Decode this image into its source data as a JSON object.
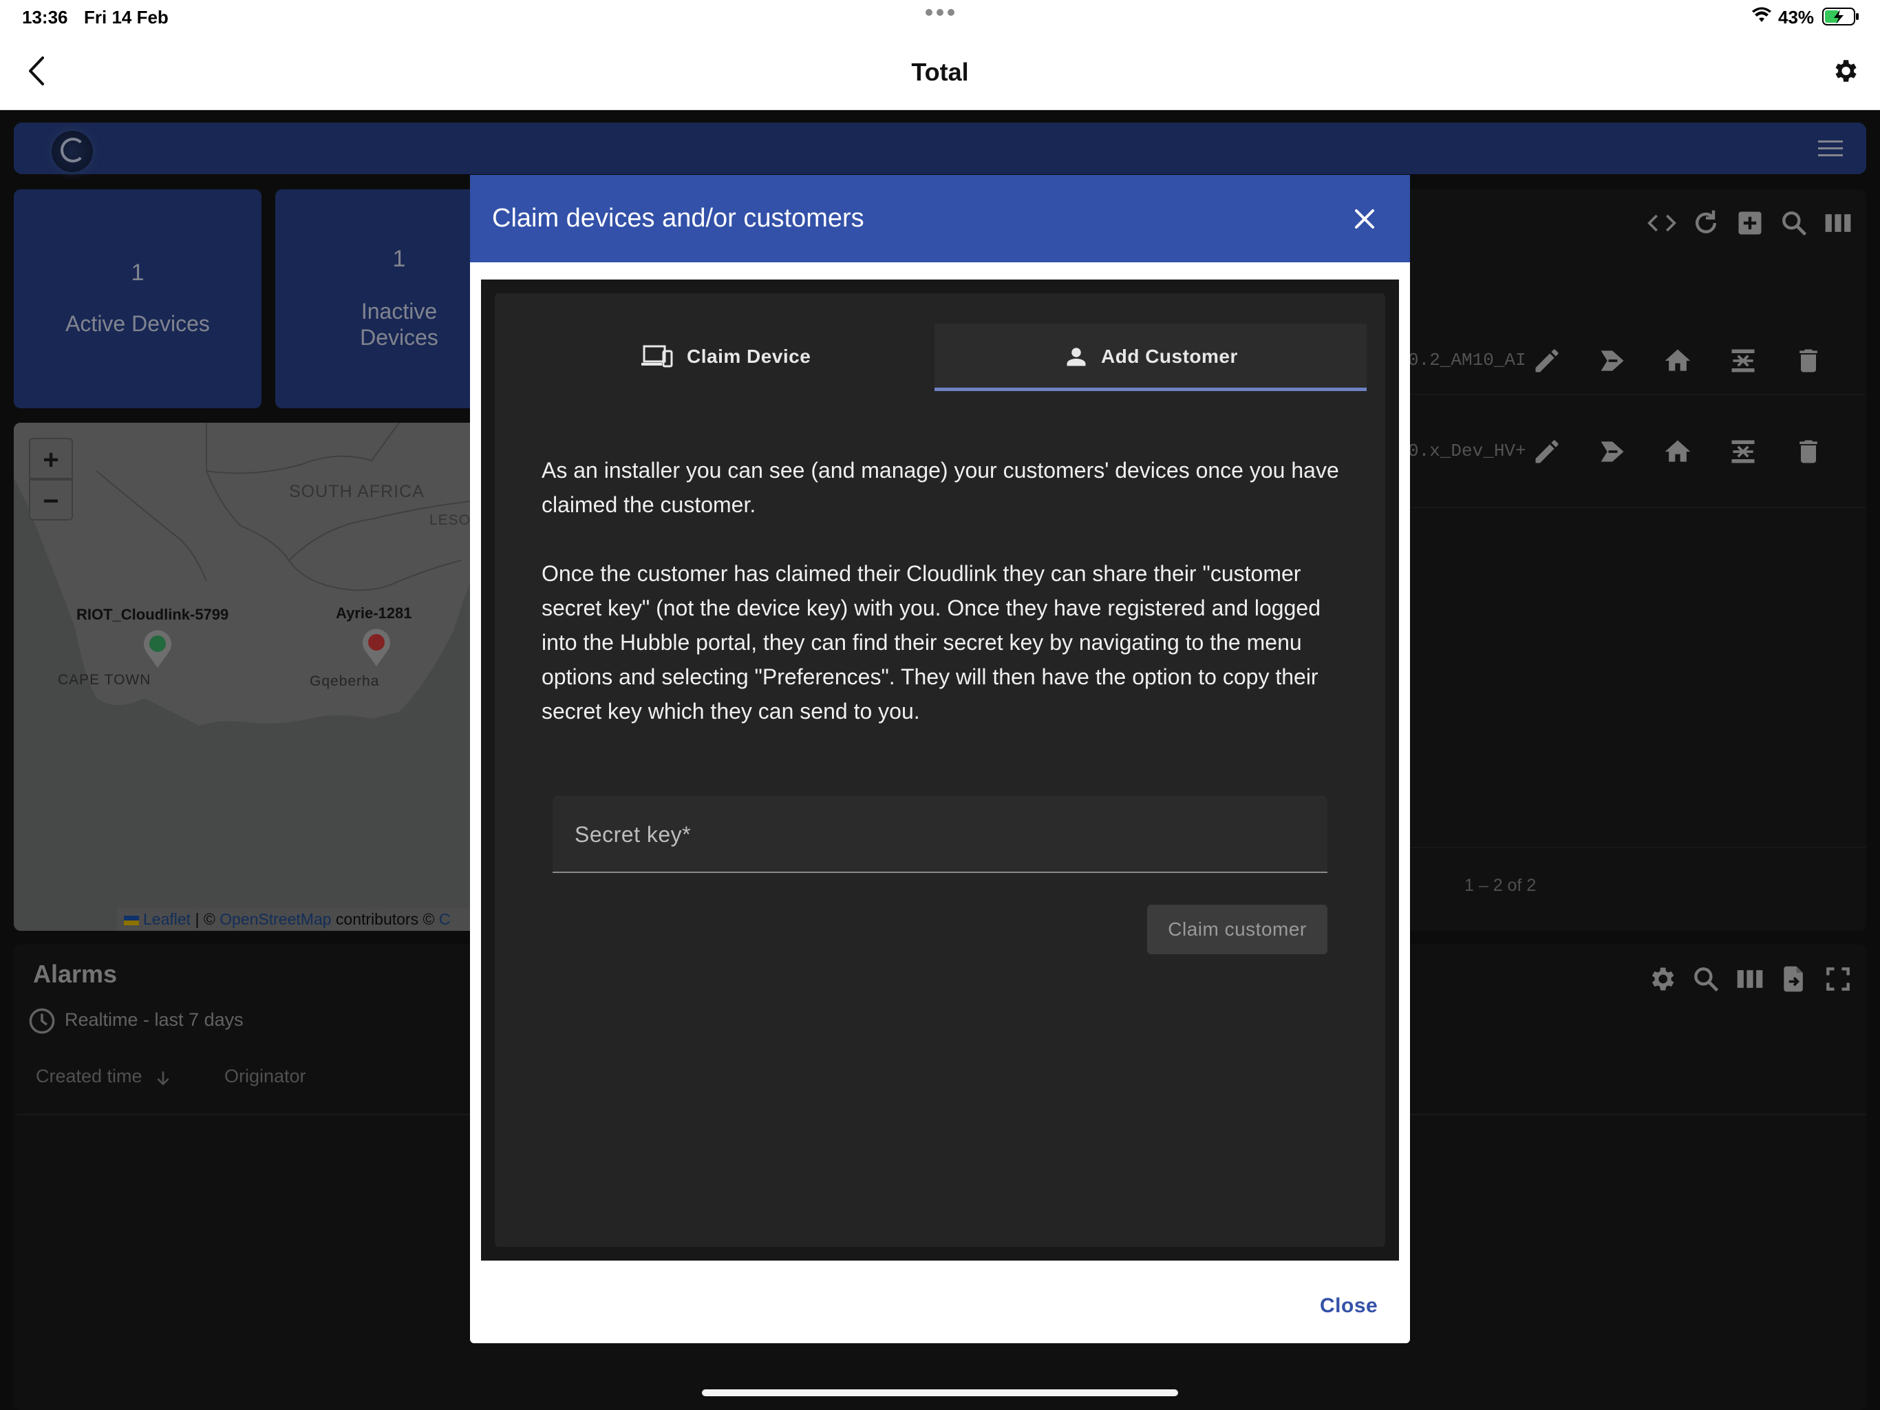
{
  "status_bar": {
    "time": "13:36",
    "date": "Fri 14 Feb",
    "battery": "43%"
  },
  "nav": {
    "title": "Total"
  },
  "cards": [
    {
      "count": "1",
      "label": "Active Devices"
    },
    {
      "count": "1",
      "label_line1": "Inactive",
      "label_line2": "Devices"
    }
  ],
  "map": {
    "region_label": "SOUTH AFRICA",
    "region_label_partial": "LESO",
    "markers": [
      {
        "name": "RIOT_Cloudlink-5799",
        "status": "active",
        "color": "#3cb56b"
      },
      {
        "name": "Ayrie-1281",
        "status": "inactive",
        "color": "#e23b3b"
      }
    ],
    "cities": [
      "CAPE TOWN",
      "Gqeberha"
    ],
    "zoom_in": "+",
    "zoom_out": "−",
    "attribution": {
      "leaflet": "Leaflet",
      "sep": " | © ",
      "osm": "OpenStreetMap",
      "contrib": " contributors © ",
      "tail": "C"
    }
  },
  "devices_table": {
    "rows": [
      {
        "name": "0.2_AM10_AI"
      },
      {
        "name": "0.x_Dev_HV+"
      }
    ],
    "pagination": "1 – 2 of 2"
  },
  "alarms": {
    "title": "Alarms",
    "timewindow": "Realtime - last 7 days",
    "columns": [
      "Created time",
      "Originator"
    ]
  },
  "dialog": {
    "title": "Claim devices and/or customers",
    "tabs": [
      {
        "label": "Claim Device",
        "icon": "devices-icon",
        "active": false
      },
      {
        "label": "Add Customer",
        "icon": "person-icon",
        "active": true
      }
    ],
    "paragraph1": "As an installer you can see (and manage) your customers' devices once you have claimed the customer.",
    "paragraph2": "Once the customer has claimed their Cloudlink they can share their \"customer secret key\" (not the device key) with you. Once they have registered and logged into the Hubble portal, they can find their secret key by navigating to the menu options and selecting \"Preferences\". They will then have the option to copy their secret key which they can send to you.",
    "secret_key_label": "Secret key",
    "required_marker": "*",
    "claim_button": "Claim customer",
    "close_button": "Close"
  },
  "colors": {
    "primary": "#3351a8",
    "appbar": "#2c4491",
    "background": "#161616"
  }
}
